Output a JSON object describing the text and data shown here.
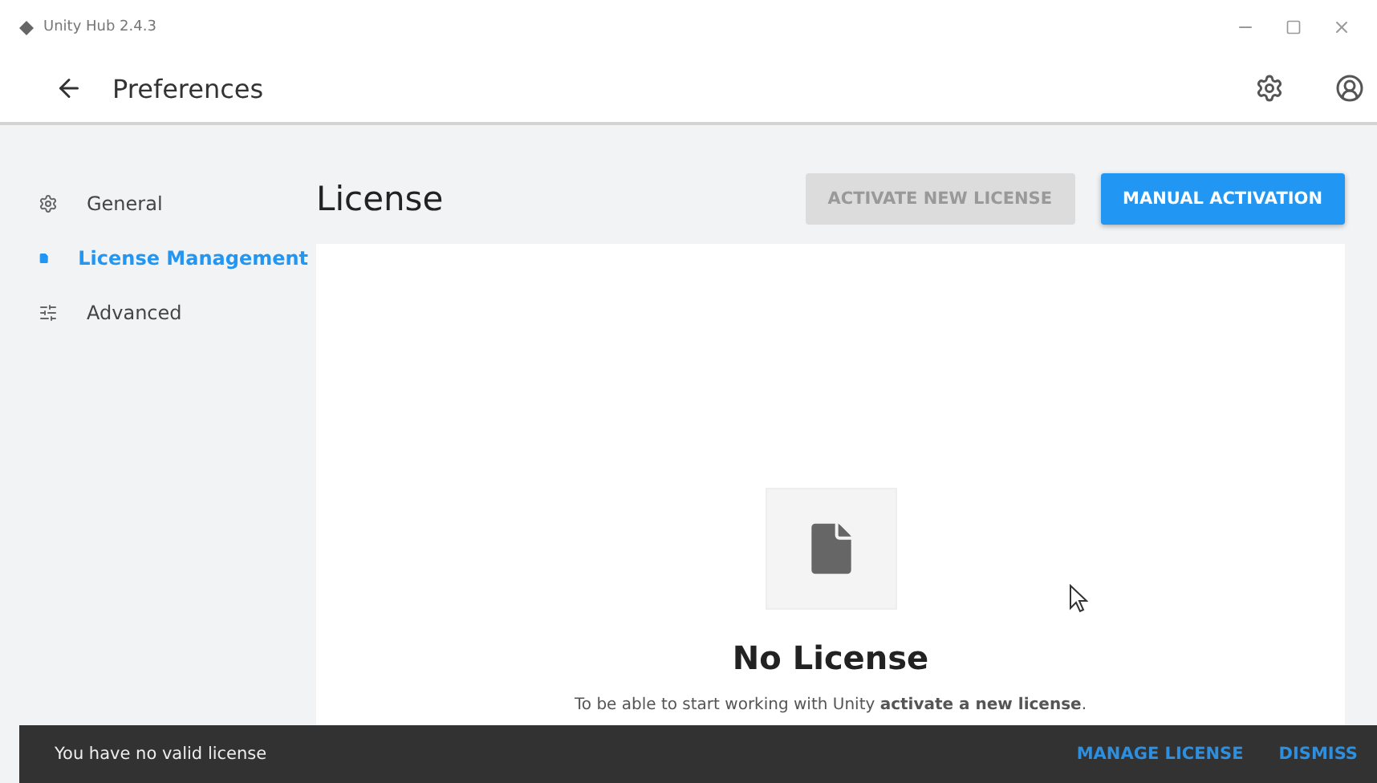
{
  "window": {
    "title": "Unity Hub 2.4.3"
  },
  "header": {
    "title": "Preferences"
  },
  "sidebar": {
    "items": [
      {
        "label": "General",
        "selected": false
      },
      {
        "label": "License Management",
        "selected": true
      },
      {
        "label": "Advanced",
        "selected": false
      }
    ]
  },
  "page": {
    "title": "License",
    "buttons": [
      {
        "label": "ACTIVATE NEW LICENSE",
        "disabled": true
      },
      {
        "label": "MANUAL ACTIVATION",
        "disabled": false
      }
    ]
  },
  "empty_state": {
    "title": "No License",
    "text": "To be able to start working with Unity **activate a new license**."
  },
  "snackbar": {
    "message": "You have no valid license",
    "actions": [
      "MANAGE LICENSE",
      "DISMISS"
    ]
  }
}
